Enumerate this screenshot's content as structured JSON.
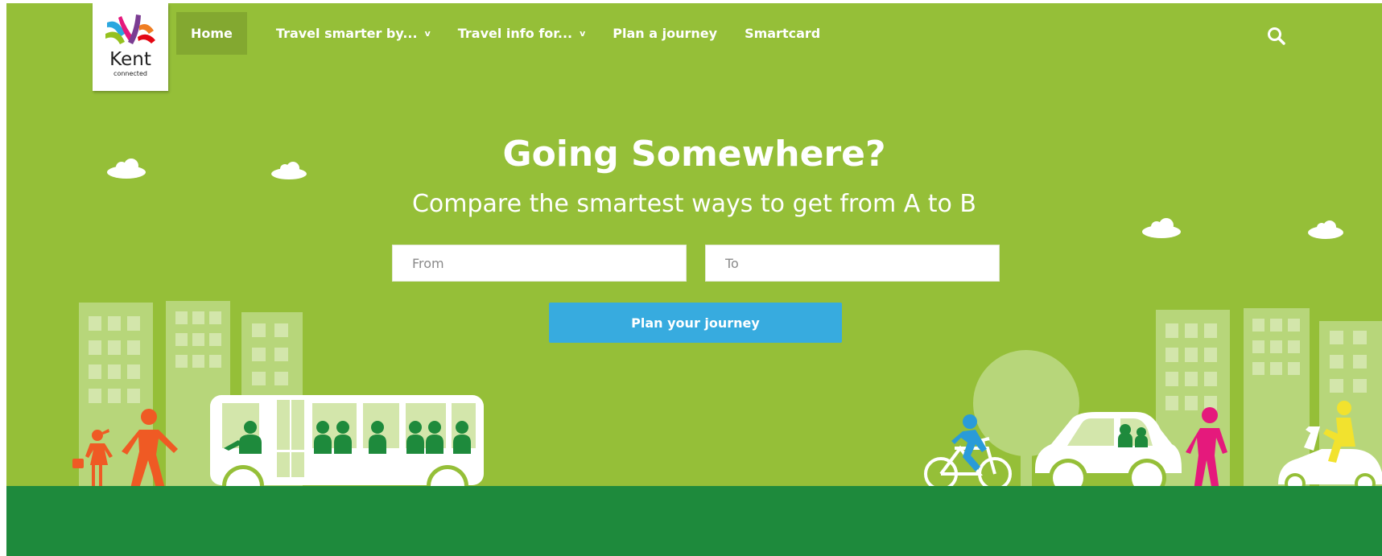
{
  "logo": {
    "title": "Kent",
    "subtitle": "connected"
  },
  "nav": {
    "items": [
      {
        "label": "Home",
        "dropdown": false,
        "active": true
      },
      {
        "label": "Travel smarter by...",
        "dropdown": true,
        "active": false
      },
      {
        "label": "Travel info for...",
        "dropdown": true,
        "active": false
      },
      {
        "label": "Plan a journey",
        "dropdown": false,
        "active": false
      },
      {
        "label": "Smartcard",
        "dropdown": false,
        "active": false
      }
    ],
    "dropdown_glyph": "v",
    "search_icon": "search-icon"
  },
  "hero": {
    "title": "Going Somewhere?",
    "subtitle": "Compare the smartest ways to get from A to B",
    "from_placeholder": "From",
    "to_placeholder": "To",
    "plan_button": "Plan your journey"
  },
  "colors": {
    "background": "#95bf38",
    "nav_active": "#83a830",
    "button": "#37abdf",
    "ground": "#1e8a3c",
    "building": "#b7d67a",
    "window": "#d3e6ab",
    "passenger": "#1e8a3c",
    "person_orange": "#ef5a24",
    "person_pink": "#e5197c",
    "cyclist": "#2a9bd8",
    "scooter_rider": "#f2e22e"
  }
}
